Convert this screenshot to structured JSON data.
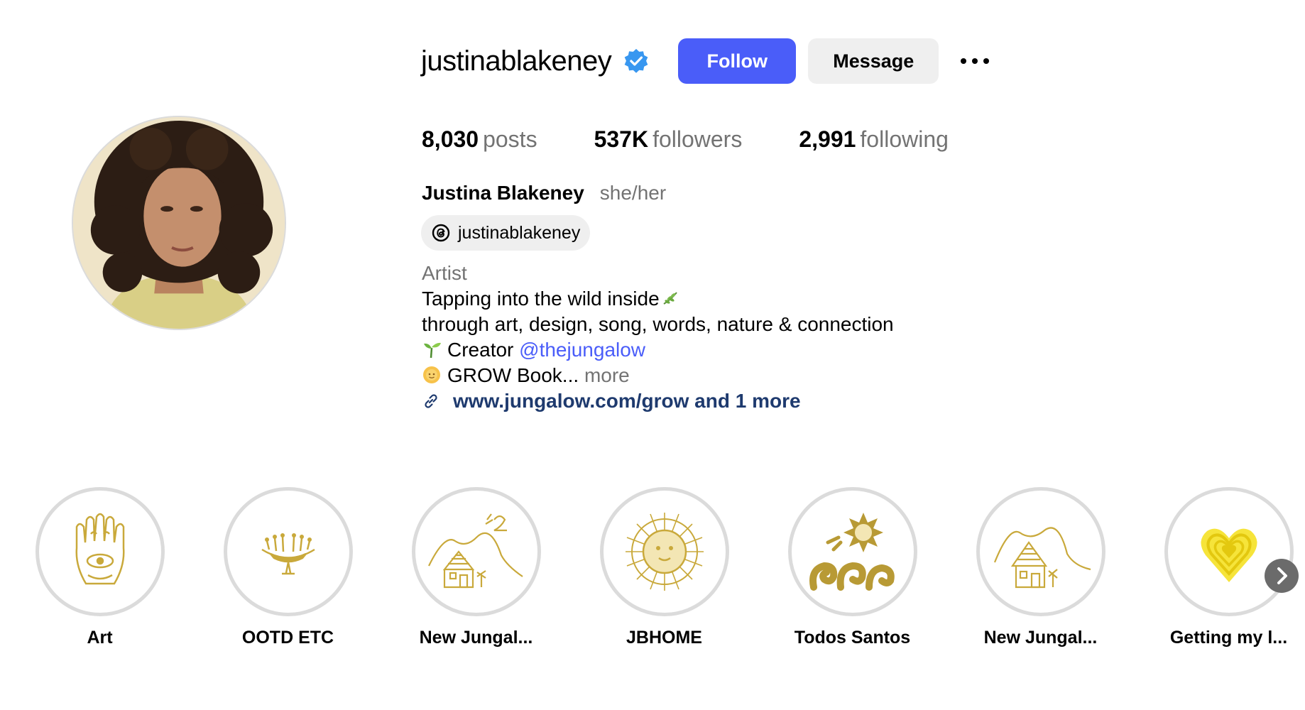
{
  "profile": {
    "username": "justinablakeney",
    "verified": true,
    "follow_label": "Follow",
    "message_label": "Message",
    "full_name": "Justina Blakeney",
    "pronouns": "she/her",
    "threads_handle": "justinablakeney"
  },
  "stats": {
    "posts_count": "8,030",
    "posts_label": "posts",
    "followers_count": "537K",
    "followers_label": "followers",
    "following_count": "2,991",
    "following_label": "following"
  },
  "bio": {
    "category": "Artist",
    "line1": "Tapping into the wild inside",
    "line2": "through art, design, song, words, nature & connection",
    "line3_prefix": "Creator",
    "line3_mention": "@thejungalow",
    "line4": "GROW Book...",
    "more_label": "more",
    "link": "www.jungalow.com/grow and 1 more"
  },
  "highlights": [
    {
      "label": "Art",
      "icon": "hamsa-icon"
    },
    {
      "label": "OOTD ETC",
      "icon": "flower-bowl-icon"
    },
    {
      "label": "New Jungal...",
      "icon": "house-2-icon"
    },
    {
      "label": "JBHOME",
      "icon": "sun-face-icon"
    },
    {
      "label": "Todos Santos",
      "icon": "sun-waves-icon"
    },
    {
      "label": "New Jungal...",
      "icon": "house-icon"
    },
    {
      "label": "Getting my l...",
      "icon": "heart-icon"
    }
  ],
  "colors": {
    "primary_button": "#4a5df9",
    "secondary_button": "#efefef",
    "link": "#1e3a6e",
    "mention": "#4a5df9",
    "muted": "#737373",
    "verified": "#3897f0",
    "highlight_gold": "#c9a93b"
  }
}
